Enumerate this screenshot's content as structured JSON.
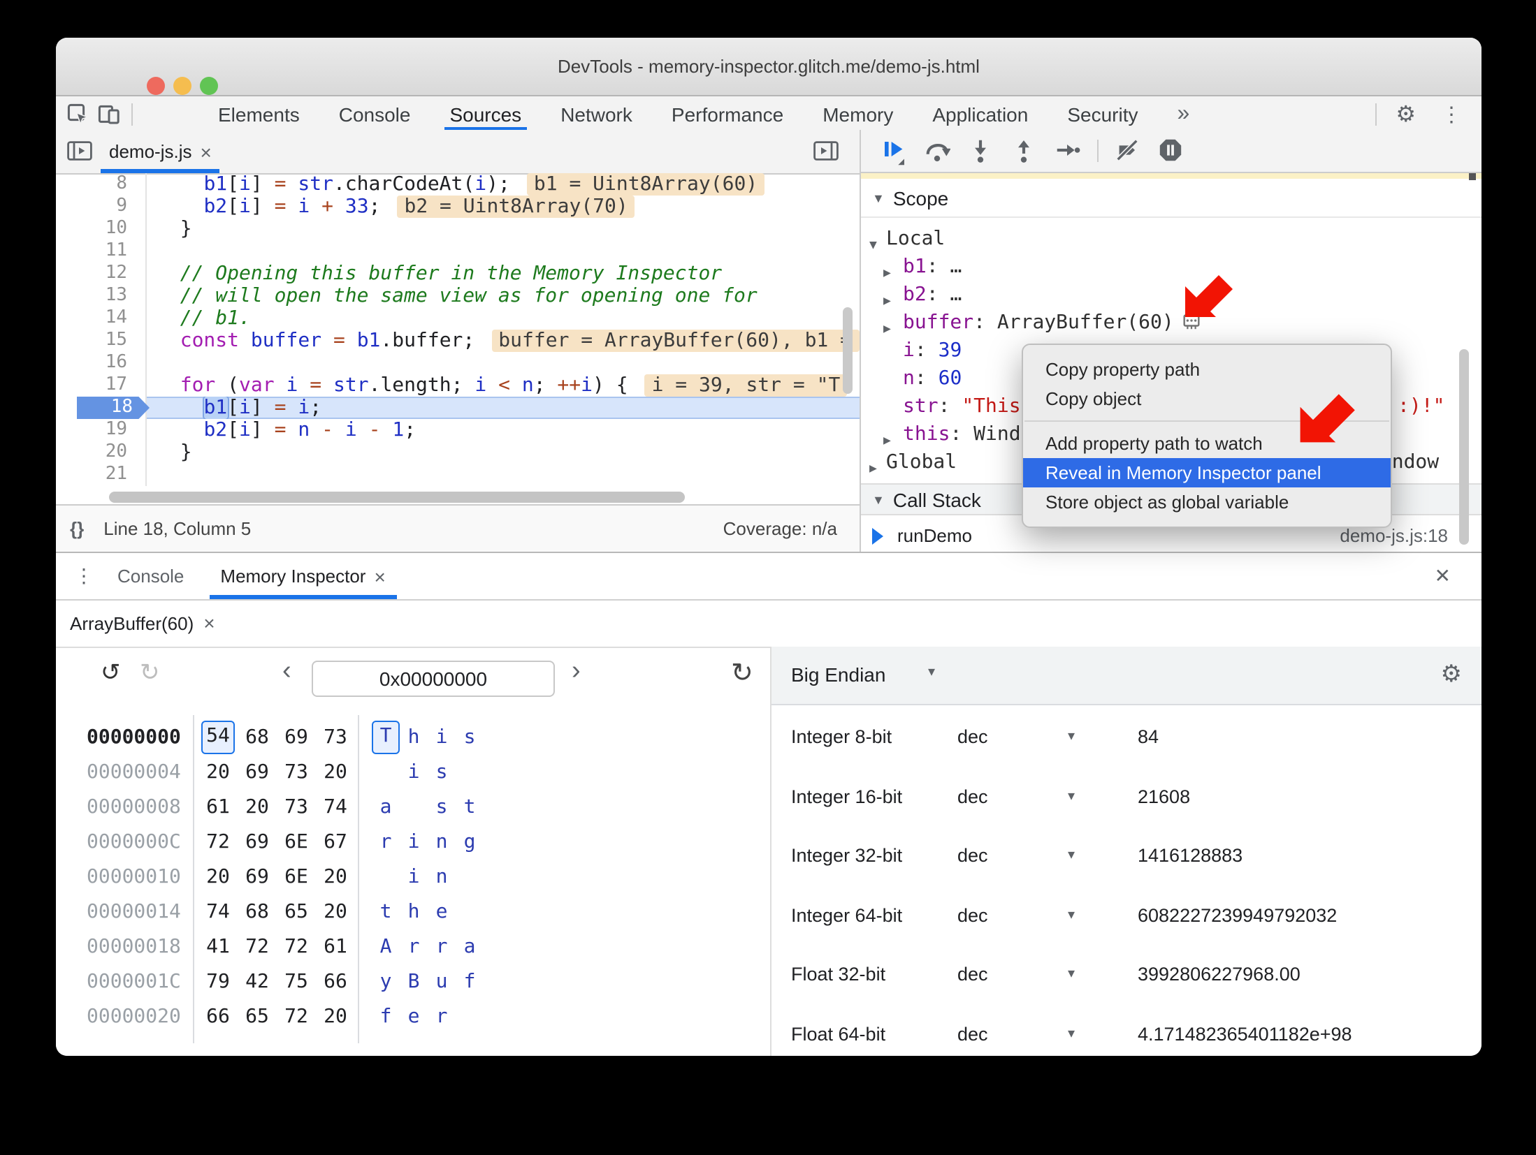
{
  "colors": {
    "accent": "#1a73e8",
    "menu_selection": "#2e6be6",
    "arrow_red": "#f21404",
    "exec_line_bg": "#d7e5fb",
    "annotation_bg": "#f7e3c5",
    "string_value": "#c41a16",
    "number_value": "#1c2ec8",
    "property_key": "#881391",
    "comment": "#1d7a1d",
    "keyword": "#a31db1",
    "operator": "#a8431e",
    "variable": "#1f2fc4",
    "traffic_close": "#ee6a5e",
    "traffic_min": "#f5bd4f",
    "traffic_zoom": "#61c454"
  },
  "glyphs": {
    "gear": "⚙",
    "kebab": "⋮",
    "overflow": "»",
    "undo": "↺",
    "redo": "↻",
    "refresh": "↻",
    "chev_left": "‹",
    "chev_right": "›",
    "caret": "▾",
    "tri_open": "▼",
    "tri_closed": "▶",
    "close_x": "×",
    "drawer_close": "✕",
    "braces": "{}"
  },
  "window": {
    "title": "DevTools - memory-inspector.glitch.me/demo-js.html"
  },
  "main_toolbar": {
    "tabs": [
      "Elements",
      "Console",
      "Sources",
      "Network",
      "Performance",
      "Memory",
      "Application",
      "Security"
    ],
    "active_tab": "Sources"
  },
  "sources_panel": {
    "file_tab": {
      "label": "demo-js.js",
      "close": "×"
    },
    "status_bar": {
      "braces": "{}",
      "line_col": "Line 18, Column 5",
      "coverage": "Coverage: n/a"
    },
    "code": {
      "lines": [
        {
          "n": 8,
          "segs": [
            [
              "pl",
              "    "
            ],
            [
              "vr",
              "b1"
            ],
            [
              "pl",
              "["
            ],
            [
              "vr",
              "i"
            ],
            [
              "pl",
              "] "
            ],
            [
              "op",
              "="
            ],
            [
              "pl",
              " "
            ],
            [
              "vr",
              "str"
            ],
            [
              "pl",
              ".charCodeAt("
            ],
            [
              "vr",
              "i"
            ],
            [
              "pl",
              ");"
            ]
          ],
          "ann": "b1 = Uint8Array(60)"
        },
        {
          "n": 9,
          "segs": [
            [
              "pl",
              "    "
            ],
            [
              "vr",
              "b2"
            ],
            [
              "pl",
              "["
            ],
            [
              "vr",
              "i"
            ],
            [
              "pl",
              "] "
            ],
            [
              "op",
              "="
            ],
            [
              "pl",
              " "
            ],
            [
              "vr",
              "i"
            ],
            [
              "pl",
              " "
            ],
            [
              "op",
              "+"
            ],
            [
              "pl",
              " "
            ],
            [
              "nm",
              "33"
            ],
            [
              "pl",
              ";"
            ]
          ],
          "ann": "b2 = Uint8Array(70)"
        },
        {
          "n": 10,
          "segs": [
            [
              "pl",
              "  }"
            ]
          ]
        },
        {
          "n": 11,
          "segs": []
        },
        {
          "n": 12,
          "segs": [
            [
              "cm",
              "  // Opening this buffer in the Memory Inspector"
            ]
          ]
        },
        {
          "n": 13,
          "segs": [
            [
              "cm",
              "  // will open the same view as for opening one for"
            ]
          ]
        },
        {
          "n": 14,
          "segs": [
            [
              "cm",
              "  // b1."
            ]
          ]
        },
        {
          "n": 15,
          "segs": [
            [
              "pl",
              "  "
            ],
            [
              "kw",
              "const"
            ],
            [
              "pl",
              " "
            ],
            [
              "vr",
              "buffer"
            ],
            [
              "pl",
              " "
            ],
            [
              "op",
              "="
            ],
            [
              "pl",
              " "
            ],
            [
              "vr",
              "b1"
            ],
            [
              "pl",
              ".buffer;"
            ]
          ],
          "ann": "buffer = ArrayBuffer(60), b1 ="
        },
        {
          "n": 16,
          "segs": []
        },
        {
          "n": 17,
          "segs": [
            [
              "pl",
              "  "
            ],
            [
              "kw",
              "for"
            ],
            [
              "pl",
              " ("
            ],
            [
              "kw",
              "var"
            ],
            [
              "pl",
              " "
            ],
            [
              "vr",
              "i"
            ],
            [
              "pl",
              " "
            ],
            [
              "op",
              "="
            ],
            [
              "pl",
              " "
            ],
            [
              "vr",
              "str"
            ],
            [
              "pl",
              ".length; "
            ],
            [
              "vr",
              "i"
            ],
            [
              "pl",
              " "
            ],
            [
              "op",
              "<"
            ],
            [
              "pl",
              " "
            ],
            [
              "vr",
              "n"
            ],
            [
              "pl",
              "; "
            ],
            [
              "op",
              "++"
            ],
            [
              "vr",
              "i"
            ],
            [
              "pl",
              ") {"
            ]
          ],
          "ann": "i = 39, str = \"T"
        },
        {
          "n": 18,
          "segs": [
            [
              "pl",
              "    "
            ],
            [
              "vs",
              "b1"
            ],
            [
              "pl",
              "["
            ],
            [
              "vr",
              "i"
            ],
            [
              "pl",
              "] "
            ],
            [
              "op",
              "="
            ],
            [
              "pl",
              " "
            ],
            [
              "vr",
              "i"
            ],
            [
              "pl",
              ";"
            ]
          ],
          "exec": true
        },
        {
          "n": 19,
          "segs": [
            [
              "pl",
              "    "
            ],
            [
              "vr",
              "b2"
            ],
            [
              "pl",
              "["
            ],
            [
              "vr",
              "i"
            ],
            [
              "pl",
              "] "
            ],
            [
              "op",
              "="
            ],
            [
              "pl",
              " "
            ],
            [
              "vr",
              "n"
            ],
            [
              "pl",
              " "
            ],
            [
              "op",
              "-"
            ],
            [
              "pl",
              " "
            ],
            [
              "vr",
              "i"
            ],
            [
              "pl",
              " "
            ],
            [
              "op",
              "-"
            ],
            [
              "pl",
              " "
            ],
            [
              "nm",
              "1"
            ],
            [
              "pl",
              ";"
            ]
          ]
        },
        {
          "n": 20,
          "segs": [
            [
              "pl",
              "  }"
            ]
          ]
        },
        {
          "n": 21,
          "segs": []
        }
      ]
    }
  },
  "debugger_panel": {
    "scope": {
      "title": "Scope",
      "rows": [
        {
          "lvl": 1,
          "exp": "open",
          "name": "Local",
          "cls": "section"
        },
        {
          "lvl": 2,
          "exp": "closed",
          "name": "b1",
          "val": "…"
        },
        {
          "lvl": 2,
          "exp": "closed",
          "name": "b2",
          "val": "…"
        },
        {
          "lvl": 2,
          "exp": "closed",
          "name": "buffer",
          "val": "ArrayBuffer(60)",
          "chip": true
        },
        {
          "lvl": 2,
          "name": "i",
          "val": "39",
          "vcls": "num"
        },
        {
          "lvl": 2,
          "name": "n",
          "val": "60",
          "vcls": "num"
        },
        {
          "lvl": 2,
          "name": "str",
          "val": "\"This is a string in the ArrayBuffer :)!\"",
          "vcls": "str"
        },
        {
          "lvl": 2,
          "exp": "closed",
          "name": "this",
          "val": "Window"
        },
        {
          "lvl": 1,
          "exp": "closed",
          "name": "Global",
          "cls": "section",
          "val": "Window",
          "far": true
        }
      ]
    },
    "call_stack": {
      "title": "Call Stack",
      "frames": [
        {
          "fn": "runDemo",
          "loc": "demo-js.js:18"
        }
      ]
    }
  },
  "context_menu": {
    "items": [
      "Copy property path",
      "Copy object",
      "separator",
      "Add property path to watch",
      "Reveal in Memory Inspector panel",
      "Store object as global variable"
    ],
    "active": "Reveal in Memory Inspector panel"
  },
  "drawer": {
    "tabs": [
      {
        "label": "Console"
      },
      {
        "label": "Memory Inspector",
        "close": "×",
        "active": true
      }
    ]
  },
  "memory_inspector": {
    "buffer_tab": {
      "label": "ArrayBuffer(60)",
      "close": "×"
    },
    "address": "0x00000000",
    "hex": {
      "rows": [
        {
          "addr": "00000000",
          "bytes": [
            "54",
            "68",
            "69",
            "73"
          ],
          "ascii": [
            "T",
            "h",
            "i",
            "s"
          ],
          "sel": 0
        },
        {
          "addr": "00000004",
          "bytes": [
            "20",
            "69",
            "73",
            "20"
          ],
          "ascii": [
            "",
            "i",
            "s",
            ""
          ]
        },
        {
          "addr": "00000008",
          "bytes": [
            "61",
            "20",
            "73",
            "74"
          ],
          "ascii": [
            "a",
            "",
            "s",
            "t"
          ]
        },
        {
          "addr": "0000000C",
          "bytes": [
            "72",
            "69",
            "6E",
            "67"
          ],
          "ascii": [
            "r",
            "i",
            "n",
            "g"
          ]
        },
        {
          "addr": "00000010",
          "bytes": [
            "20",
            "69",
            "6E",
            "20"
          ],
          "ascii": [
            "",
            "i",
            "n",
            ""
          ]
        },
        {
          "addr": "00000014",
          "bytes": [
            "74",
            "68",
            "65",
            "20"
          ],
          "ascii": [
            "t",
            "h",
            "e",
            ""
          ]
        },
        {
          "addr": "00000018",
          "bytes": [
            "41",
            "72",
            "72",
            "61"
          ],
          "ascii": [
            "A",
            "r",
            "r",
            "a"
          ]
        },
        {
          "addr": "0000001C",
          "bytes": [
            "79",
            "42",
            "75",
            "66"
          ],
          "ascii": [
            "y",
            "B",
            "u",
            "f"
          ]
        },
        {
          "addr": "00000020",
          "bytes": [
            "66",
            "65",
            "72",
            "20"
          ],
          "ascii": [
            "f",
            "e",
            "r",
            ""
          ]
        }
      ]
    },
    "interpreter": {
      "endianness": "Big Endian",
      "rows": [
        {
          "type": "Integer 8-bit",
          "fmt": "dec",
          "value": "84"
        },
        {
          "type": "Integer 16-bit",
          "fmt": "dec",
          "value": "21608"
        },
        {
          "type": "Integer 32-bit",
          "fmt": "dec",
          "value": "1416128883"
        },
        {
          "type": "Integer 64-bit",
          "fmt": "dec",
          "value": "6082227239949792032"
        },
        {
          "type": "Float 32-bit",
          "fmt": "dec",
          "value": "3992806227968.00"
        },
        {
          "type": "Float 64-bit",
          "fmt": "dec",
          "value": "4.171482365401182e+98"
        }
      ]
    }
  }
}
